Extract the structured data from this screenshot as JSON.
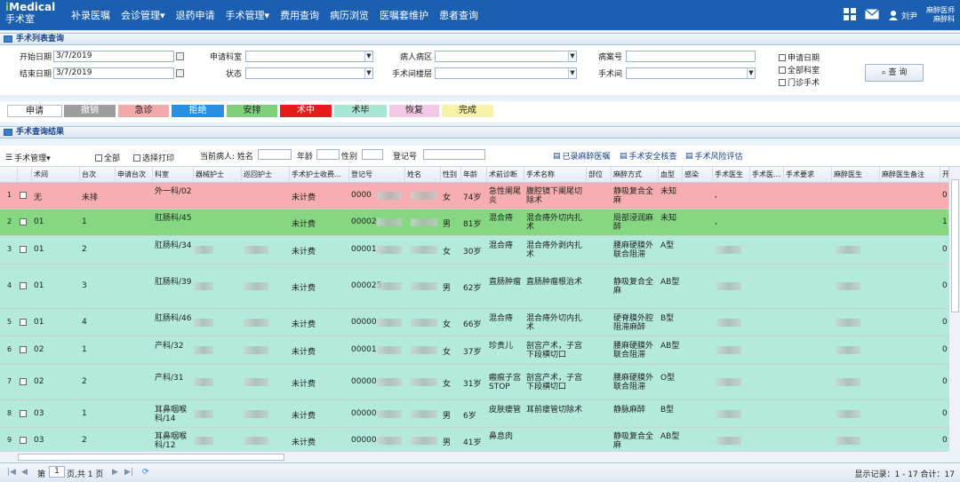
{
  "app": {
    "logo_prefix": "i",
    "logo_rest": "Medical",
    "logo_sub": "手术室"
  },
  "nav": [
    "补录医嘱",
    "会诊管理▾",
    "退药申请",
    "手术管理▾",
    "费用查询",
    "病历浏览",
    "医嘱套维护",
    "患者查询"
  ],
  "user": {
    "name": "刘尹",
    "role_line1": "麻醉医师",
    "role_line2": "麻醉科"
  },
  "search_panel": {
    "title": "手术列表查询",
    "start_date_label": "开始日期",
    "start_date_value": "3/7/2019",
    "end_date_label": "结束日期",
    "end_date_value": "3/7/2019",
    "dept_label": "申请科室",
    "state_label": "状态",
    "ward_label": "病人病区",
    "room_floor_label": "手术间楼层",
    "record_no_label": "病案号",
    "room_label": "手术间",
    "check_apply_date": "申请日期",
    "check_all_dept": "全部科室",
    "check_outpatient": "门诊手术",
    "query_button": "查 询"
  },
  "status_legend": [
    {
      "label": "申请",
      "bg": "#ffffff",
      "fg": "#222222"
    },
    {
      "label": "撤销",
      "bg": "#9e9e9e",
      "fg": "#ffffff"
    },
    {
      "label": "急诊",
      "bg": "#f2a9a9",
      "fg": "#222222"
    },
    {
      "label": "拒绝",
      "bg": "#2b8fe0",
      "fg": "#ffffff"
    },
    {
      "label": "安排",
      "bg": "#7ed07a",
      "fg": "#222222"
    },
    {
      "label": "术中",
      "bg": "#e51a1a",
      "fg": "#ffffff"
    },
    {
      "label": "术毕",
      "bg": "#a9e6d6",
      "fg": "#222222"
    },
    {
      "label": "恢复",
      "bg": "#f4c9e8",
      "fg": "#222222"
    },
    {
      "label": "完成",
      "bg": "#f6f3a8",
      "fg": "#222222"
    }
  ],
  "results_panel": {
    "title": "手术查询结果",
    "menu_label": "手术管理▾",
    "check_all": "全部",
    "check_select_print": "选择打印",
    "current_patient_label": "当前病人: 姓名",
    "age_label": "年龄",
    "gender_label": "性别",
    "reg_no_label": "登记号",
    "link_anesthesia_order": "已录麻醉医嘱",
    "link_safety_check": "手术安全核查",
    "link_risk": "手术风险评估"
  },
  "columns": [
    "",
    "",
    "术间",
    "台次",
    "申请台次",
    "科室",
    "器械护士",
    "巡回护士",
    "手术护士收费...",
    "登记号",
    "姓名",
    "性别",
    "年龄",
    "术前诊断",
    "手术名称",
    "部位",
    "麻醉方式",
    "血型",
    "感染",
    "手术医生",
    "手术医...",
    "手术要求",
    "麻醉医生",
    "麻醉医生备注",
    "开始"
  ],
  "rows": [
    {
      "no": "1",
      "room": "无",
      "seq": "未排",
      "dept": "外一科/02",
      "fee": "未计费",
      "reg": "0000",
      "gender": "女",
      "age": "74岁",
      "diag": "急性阑尾炎",
      "op": "腹腔镜下阑尾切除术",
      "anes": "静吸复合全麻",
      "blood": "未知",
      "doc": ",",
      "start": "0",
      "color": "#f6aeb0"
    },
    {
      "no": "2",
      "room": "01",
      "seq": "1",
      "dept": "肛肠科/45",
      "fee": "未计费",
      "reg": "00002",
      "gender": "男",
      "age": "81岁",
      "diag": "混合痔",
      "op": "混合痔外切内扎术",
      "anes": "局部浸润麻醉",
      "blood": "未知",
      "doc": ",",
      "start": "1",
      "color": "#86d782"
    },
    {
      "no": "3",
      "room": "01",
      "seq": "2",
      "dept": "肛肠科/34",
      "fee": "未计费",
      "reg": "00001",
      "gender": "女",
      "age": "30岁",
      "diag": "混合痔",
      "op": "混合痔外剥内扎术",
      "anes": "腰麻硬膜外联合阻滞",
      "blood": "A型",
      "doc": "",
      "start": "0",
      "color": "#b3eadb"
    },
    {
      "no": "4",
      "room": "01",
      "seq": "3",
      "dept": "肛肠科/39",
      "fee": "未计费",
      "reg": "000025",
      "gender": "男",
      "age": "62岁",
      "diag": "直肠肿瘤",
      "op": "直肠肿瘤根治术",
      "anes": "静吸复合全麻",
      "blood": "AB型",
      "doc": "",
      "start": "0",
      "color": "#b3eadb"
    },
    {
      "no": "5",
      "room": "01",
      "seq": "4",
      "dept": "肛肠科/46",
      "fee": "未计费",
      "reg": "00000",
      "gender": "女",
      "age": "66岁",
      "diag": "混合痔",
      "op": "混合痔外切内扎术",
      "anes": "硬脊膜外腔阻滞麻醉",
      "blood": "B型",
      "doc": "",
      "start": "0",
      "color": "#b3eadb"
    },
    {
      "no": "6",
      "room": "02",
      "seq": "1",
      "dept": "产科/32",
      "fee": "未计费",
      "reg": "00001",
      "gender": "女",
      "age": "37岁",
      "diag": "珍贵儿",
      "op": "剖宫产术，子宫下段横切口",
      "anes": "腰麻硬膜外联合阻滞",
      "blood": "AB型",
      "doc": "",
      "start": "0",
      "color": "#b3eadb"
    },
    {
      "no": "7",
      "room": "02",
      "seq": "2",
      "dept": "产科/31",
      "fee": "未计费",
      "reg": "00000",
      "gender": "女",
      "age": "31岁",
      "diag": "瘢痕子宫 STOP",
      "op": "剖宫产术，子宫下段横切口",
      "anes": "腰麻硬膜外联合阻滞",
      "blood": "O型",
      "doc": "",
      "start": "0",
      "color": "#b3eadb"
    },
    {
      "no": "8",
      "room": "03",
      "seq": "1",
      "dept": "耳鼻咽喉科/14",
      "fee": "未计费",
      "reg": "00000",
      "gender": "男",
      "age": "6岁",
      "diag": "皮肤瘘管",
      "op": "耳前瘘管切除术",
      "anes": "静脉麻醉",
      "blood": "B型",
      "doc": "",
      "start": "0",
      "color": "#b3eadb"
    },
    {
      "no": "9",
      "room": "03",
      "seq": "2",
      "dept": "耳鼻咽喉科/12",
      "fee": "未计费",
      "reg": "00000",
      "gender": "男",
      "age": "41岁",
      "diag": "鼻息肉",
      "op": "",
      "anes": "静吸复合全麻",
      "blood": "AB型",
      "doc": "",
      "start": "0",
      "color": "#b3eadb"
    }
  ],
  "pager": {
    "page_label": "第",
    "page_value": "1",
    "page_suffix": "页,共 1 页",
    "summary": "显示记录：1 - 17 合计：17"
  }
}
